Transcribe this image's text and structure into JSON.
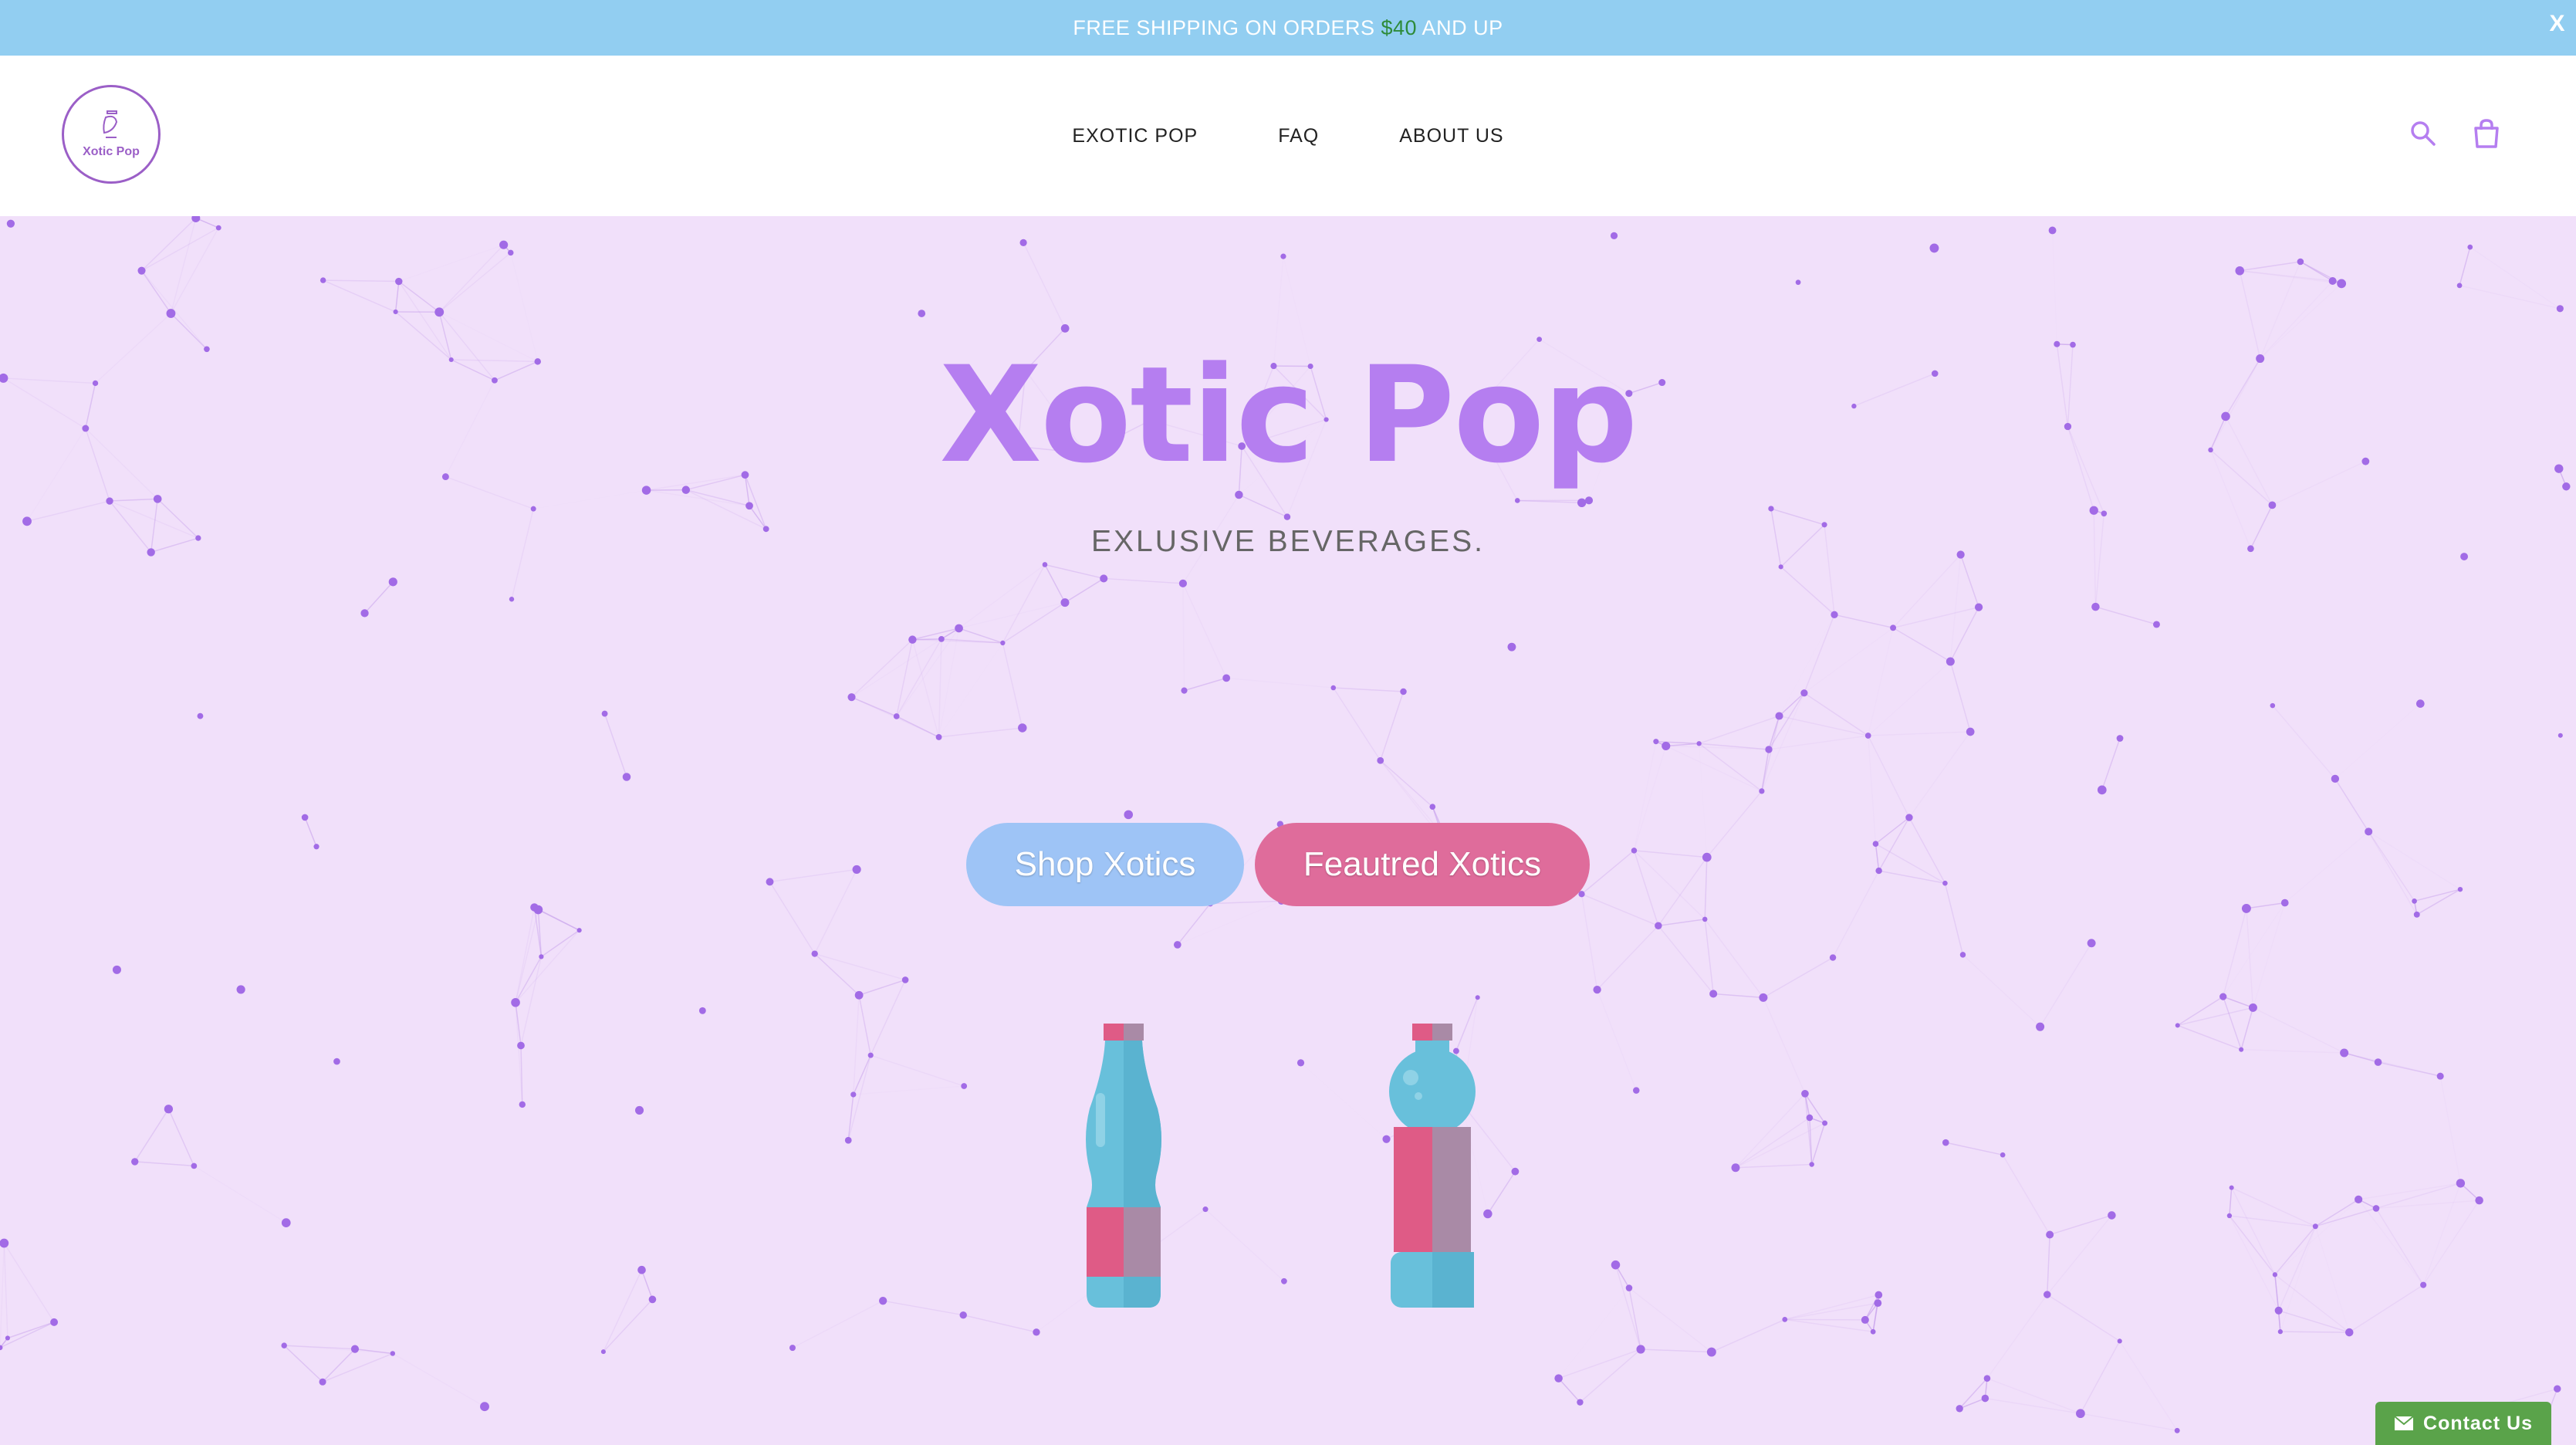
{
  "announcement": {
    "text_before": "FREE SHIPPING ON ORDERS ",
    "price": "$40",
    "text_after": " AND UP",
    "close_label": "X"
  },
  "header": {
    "logo_text": "Xotic Pop",
    "nav": [
      {
        "label": "EXOTIC POP"
      },
      {
        "label": "FAQ"
      },
      {
        "label": "ABOUT US"
      }
    ],
    "icons": [
      "search-icon",
      "cart-icon"
    ]
  },
  "hero": {
    "title": "Xotic Pop",
    "subtitle": "EXLUSIVE BEVERAGES.",
    "buttons": {
      "shop": "Shop Xotics",
      "featured": "Feautred Xotics"
    }
  },
  "contact": {
    "label": "Contact Us",
    "icon": "envelope-icon"
  },
  "colors": {
    "announcement_bg": "#92cef1",
    "hero_bg": "#f1e0fa",
    "brand_purple": "#b57ef0",
    "shop_button": "#9ec4f6",
    "featured_button": "#df6c9b",
    "contact_green": "#5aa34a"
  }
}
